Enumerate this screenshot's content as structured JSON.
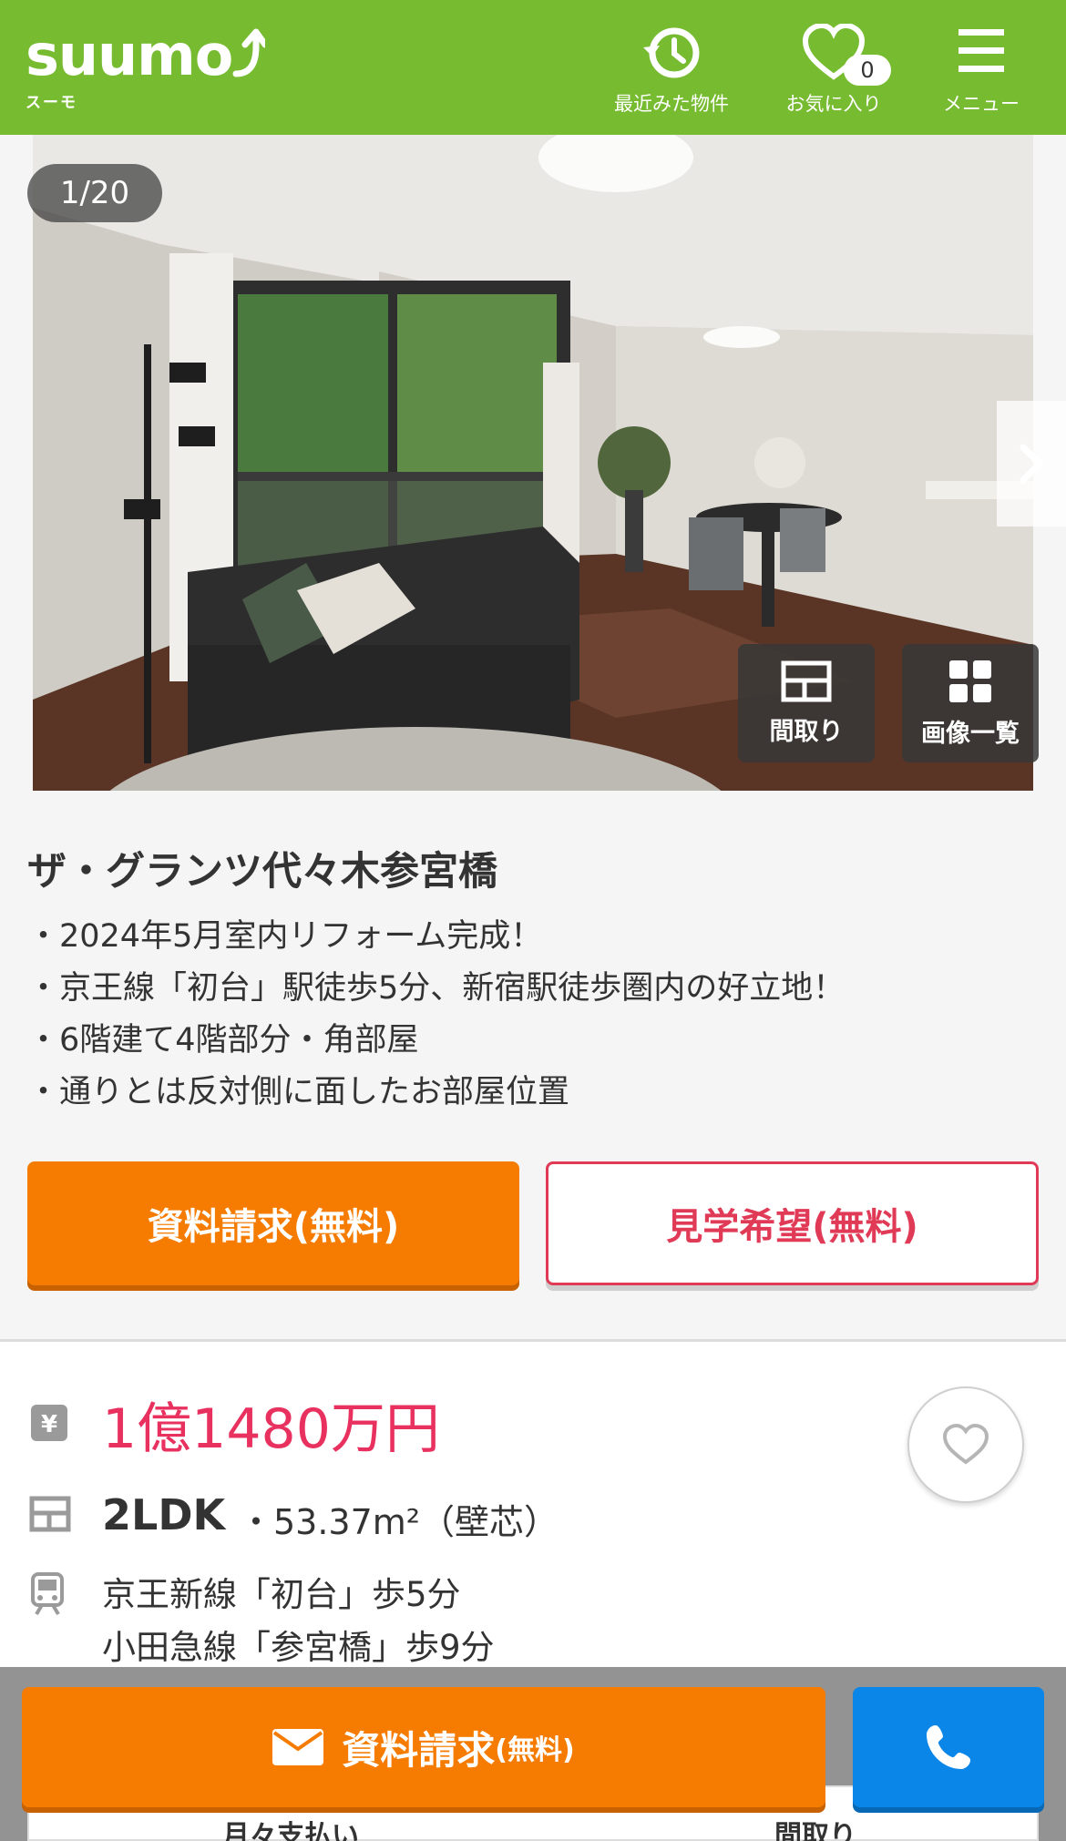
{
  "header": {
    "logo_text": "suumo",
    "logo_sub": "スーモ",
    "nav": [
      {
        "label": "最近みた物件",
        "icon": "history-icon"
      },
      {
        "label": "お気に入り",
        "icon": "heart-icon",
        "badge": "0"
      },
      {
        "label": "メニュー",
        "icon": "menu-icon"
      }
    ]
  },
  "gallery": {
    "counter": "1/20",
    "tiles": [
      {
        "label": "間取り",
        "icon": "floorplan-icon"
      },
      {
        "label": "画像一覧",
        "icon": "grid-icon"
      }
    ]
  },
  "property": {
    "title": "ザ・グランツ代々木参宮橋",
    "points": [
      "・2024年5月室内リフォーム完成！",
      "・京王線「初台」駅徒歩5分、新宿駅徒歩圏内の好立地！",
      "・6階建て4階部分・角部屋",
      "・通りとは反対側に面したお部屋位置"
    ],
    "buttons": {
      "request": "資料請求(無料)",
      "visit": "見学希望(無料)"
    },
    "price": "1億1480万円",
    "layout": "2LDK",
    "area": "・53.37m²（壁芯）",
    "stations": [
      "京王新線「初台」歩5分",
      "小田急線「参宮橋」歩9分"
    ]
  },
  "sticky": {
    "request_label": "資料請求",
    "request_sub": "(無料)",
    "peek_left": "月々支払い",
    "peek_right": "間取り"
  },
  "colors": {
    "header_green": "#76bb30",
    "orange": "#f57c00",
    "pink": "#e8315f",
    "blue": "#0a86e8"
  }
}
